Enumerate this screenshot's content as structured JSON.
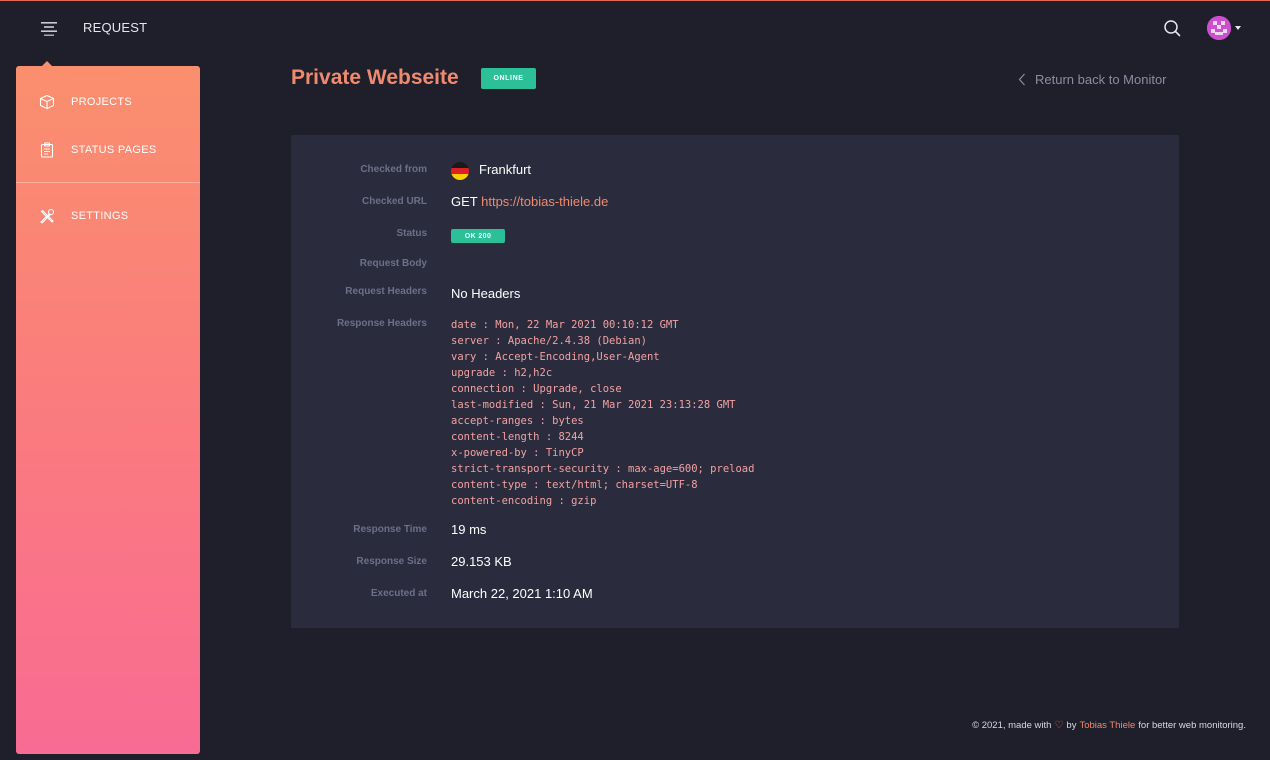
{
  "topbar": {
    "title": "REQUEST"
  },
  "sidebar": {
    "items": [
      {
        "label": "PROJECTS"
      },
      {
        "label": "STATUS PAGES"
      },
      {
        "label": "SETTINGS"
      }
    ]
  },
  "page": {
    "title": "Private Webseite",
    "status_badge": "ONLINE",
    "back_link": "Return back to Monitor"
  },
  "request": {
    "checked_from_label": "Checked from",
    "checked_from_value": "Frankfurt",
    "checked_url_label": "Checked URL",
    "method": "GET",
    "url": "https://tobias-thiele.de",
    "status_label": "Status",
    "status_value": "OK 200",
    "request_body_label": "Request Body",
    "request_headers_label": "Request Headers",
    "request_headers_value": "No Headers",
    "response_headers_label": "Response Headers",
    "response_headers": [
      "date : Mon, 22 Mar 2021 00:10:12 GMT",
      "server : Apache/2.4.38 (Debian)",
      "vary : Accept-Encoding,User-Agent",
      "upgrade : h2,h2c",
      "connection : Upgrade, close",
      "last-modified : Sun, 21 Mar 2021 23:13:28 GMT",
      "accept-ranges : bytes",
      "content-length : 8244",
      "x-powered-by : TinyCP",
      "strict-transport-security : max-age=600; preload",
      "content-type : text/html; charset=UTF-8",
      "content-encoding : gzip"
    ],
    "response_time_label": "Response Time",
    "response_time_value": "19 ms",
    "response_size_label": "Response Size",
    "response_size_value": "29.153 KB",
    "executed_at_label": "Executed at",
    "executed_at_value": "March 22, 2021 1:10 AM"
  },
  "footer": {
    "prefix": "© 2021, made with",
    "by": "by",
    "author": "Tobias Thiele",
    "suffix": "for better web monitoring."
  },
  "icons": {
    "menu": "menu-icon",
    "search": "search-icon",
    "projects": "box-icon",
    "status_pages": "clipboard-icon",
    "settings": "tools-icon",
    "back": "chevron-left-icon",
    "heart": "heart-icon",
    "flag": "germany-flag-icon"
  },
  "colors": {
    "accent": "#f08a6e",
    "success": "#2bc098",
    "background": "#1e1f2a",
    "card": "#2a2c3d"
  }
}
